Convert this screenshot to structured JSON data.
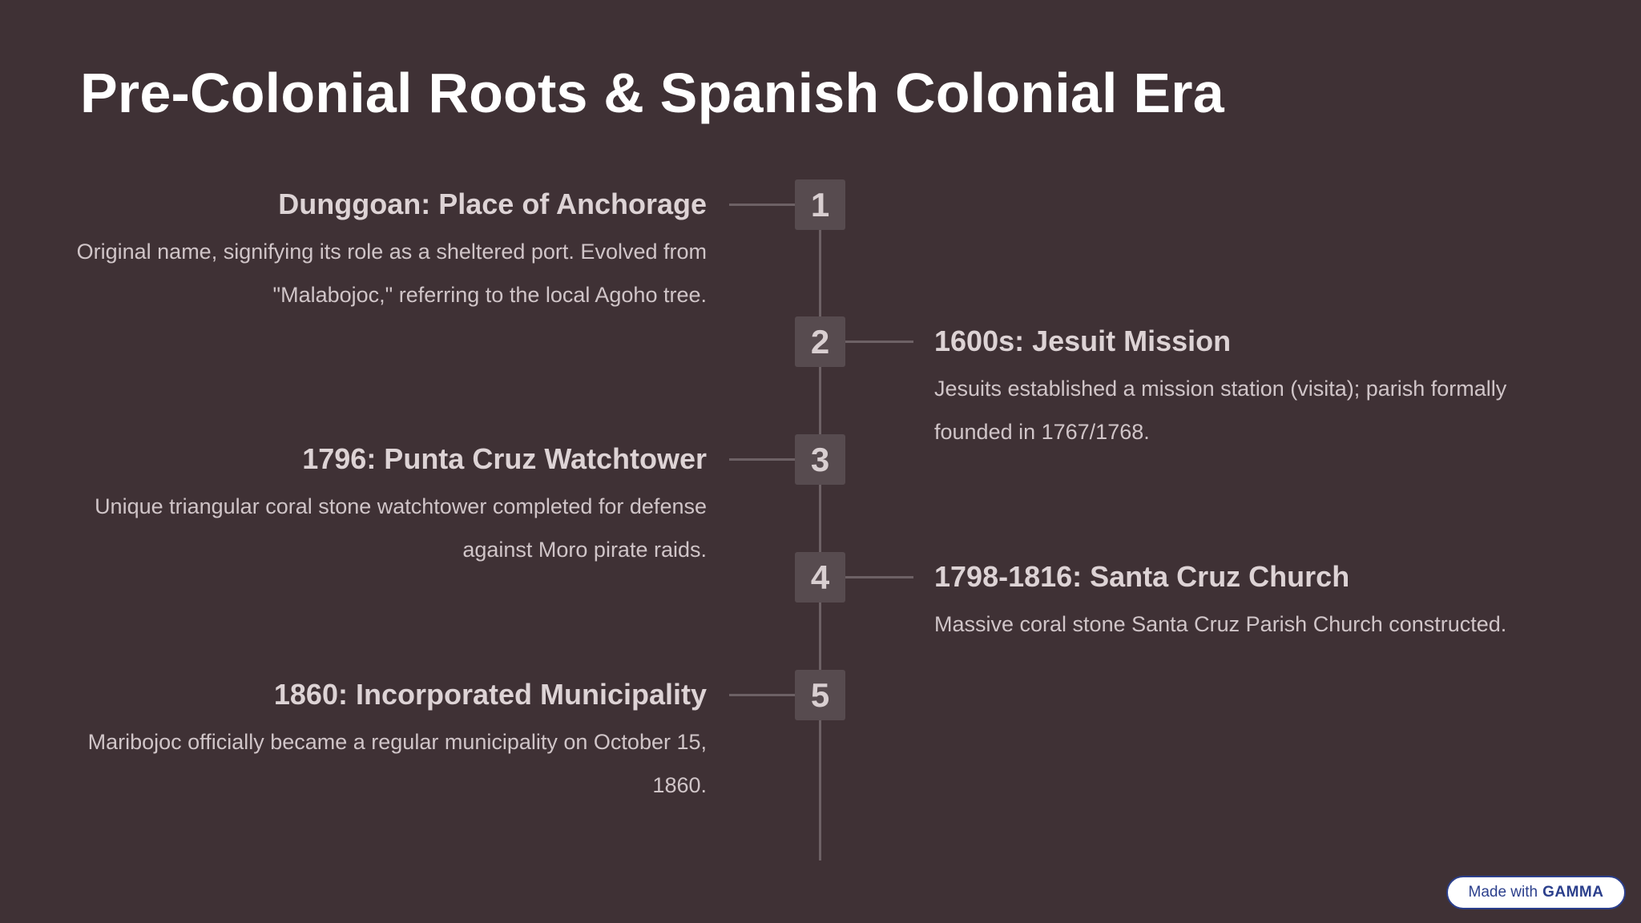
{
  "slide": {
    "title": "Pre-Colonial Roots & Spanish Colonial Era"
  },
  "timeline": [
    {
      "number": "1",
      "heading": "Dunggoan: Place of Anchorage",
      "description": "Original name, signifying its role as a sheltered port. Evolved from \"Malabojoc,\" referring to the local Agoho tree."
    },
    {
      "number": "2",
      "heading": "1600s: Jesuit Mission",
      "description": "Jesuits established a mission station (visita); parish formally founded in 1767/1768."
    },
    {
      "number": "3",
      "heading": "1796: Punta Cruz Watchtower",
      "description": "Unique triangular coral stone watchtower completed for defense against Moro pirate raids."
    },
    {
      "number": "4",
      "heading": "1798-1816: Santa Cruz Church",
      "description": "Massive coral stone Santa Cruz Parish Church constructed."
    },
    {
      "number": "5",
      "heading": "1860: Incorporated Municipality",
      "description": "Maribojoc officially became a regular municipality on October 15, 1860."
    }
  ],
  "footer": {
    "made_with": "Made with",
    "brand": "GAMMA"
  }
}
